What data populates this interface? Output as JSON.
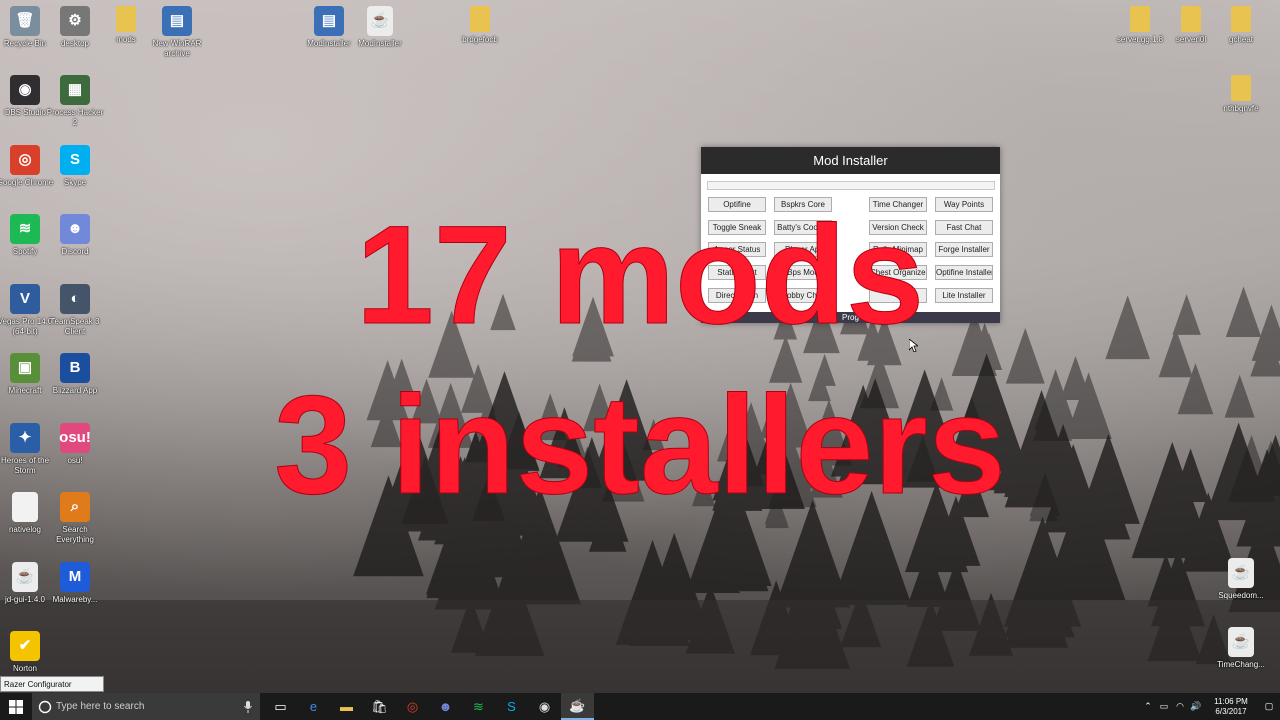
{
  "desktop": {
    "icons_left": [
      {
        "label": "Recycle Bin",
        "glyph": "🗑",
        "color": "#7a8e9e"
      },
      {
        "label": "desktop",
        "glyph": "⚙",
        "color": "#777777"
      },
      {
        "label": "mods",
        "glyph": "",
        "color": "#e8c350"
      },
      {
        "label": "New WinRAR archive",
        "glyph": "▤",
        "color": "#3b6fb6"
      },
      {
        "label": "OBS Studio",
        "glyph": "◉",
        "color": "#302e31"
      },
      {
        "label": "Process Hacker 2",
        "glyph": "▦",
        "color": "#3d6b3d"
      },
      {
        "label": "Google Chrome",
        "glyph": "◎",
        "color": "#d9402b"
      },
      {
        "label": "Skype",
        "glyph": "S",
        "color": "#00aff0"
      },
      {
        "label": "Spotify",
        "glyph": "≋",
        "color": "#1db954"
      },
      {
        "label": "Discord",
        "glyph": "☻",
        "color": "#7289da"
      },
      {
        "label": "Vegas Pro 14.0 (64-bit)",
        "glyph": "V",
        "color": "#2f5c9c"
      },
      {
        "label": "TeamSpeak 3 Client",
        "glyph": "◐",
        "color": "#44556a"
      },
      {
        "label": "Minecraft",
        "glyph": "▣",
        "color": "#5a8f3a"
      },
      {
        "label": "Blizzard App",
        "glyph": "B",
        "color": "#1b4f9e"
      },
      {
        "label": "Heroes of the Storm",
        "glyph": "✦",
        "color": "#2a5fa8"
      },
      {
        "label": "osu!",
        "glyph": "osu!",
        "color": "#e0487e"
      },
      {
        "label": "nativelog",
        "glyph": "",
        "color": "#f2f2f2"
      },
      {
        "label": "Search Everything",
        "glyph": "⌕",
        "color": "#e07b1c"
      },
      {
        "label": "jd-gui-1.4.0",
        "glyph": "☕",
        "color": "#ececec"
      },
      {
        "label": "Malwareby...",
        "glyph": "M",
        "color": "#1d5bd8"
      },
      {
        "label": "Norton",
        "glyph": "✔",
        "color": "#f5c400"
      }
    ],
    "icons_top": [
      {
        "label": "ModInstaller",
        "glyph": "▤",
        "color": "#3b6fb6"
      },
      {
        "label": "ModInstaller",
        "glyph": "☕",
        "color": "#ececec"
      },
      {
        "label": "brdgefocb",
        "glyph": "",
        "color": "#e8c350"
      }
    ],
    "icons_right": [
      {
        "label": "server.gg.1.8",
        "glyph": "",
        "color": "#e8c350"
      },
      {
        "label": "serverl0l",
        "glyph": "",
        "color": "#e8c350"
      },
      {
        "label": "gcheat",
        "glyph": "",
        "color": "#e8c350"
      },
      {
        "label": "nthbgnvfe",
        "glyph": "",
        "color": "#e8c350"
      },
      {
        "label": "Squeedom...",
        "glyph": "☕",
        "color": "#ececec"
      },
      {
        "label": "TimeChang...",
        "glyph": "☕",
        "color": "#ececec"
      }
    ]
  },
  "mod_installer": {
    "title": "Mod Installer",
    "footer": "Prog",
    "progress_fraction": 0,
    "buttons": {
      "col1": [
        "Optifine",
        "Toggle Sneak",
        "Armor Status",
        "Status Text",
        "Direct Conn"
      ],
      "col2": [
        "Bspkrs Core",
        "Batty's Coords",
        "Player Api",
        "Bps Mod",
        "Lobby Chat"
      ],
      "col3": [
        "Time Changer",
        "Version Check",
        "Rei's Minimap",
        "Chest Organizer",
        ""
      ],
      "col4": [
        "Way Points",
        "Fast Chat",
        "Forge Installer",
        "Optifine Installer",
        "Lite Installer"
      ]
    }
  },
  "overlay": {
    "line1": "17 mods",
    "line2": "3 installers",
    "color": "#ff1a2e"
  },
  "tooltip": "Razer Configurator",
  "taskbar": {
    "search_placeholder": "Type here to search",
    "apps": [
      {
        "icon": "task-view-icon",
        "glyph": "▭",
        "color": "#ffffff"
      },
      {
        "icon": "edge-icon",
        "glyph": "e",
        "color": "#3b8ee6"
      },
      {
        "icon": "file-explorer-icon",
        "glyph": "▬",
        "color": "#e8c350"
      },
      {
        "icon": "store-icon",
        "glyph": "🛍",
        "color": "#ffffff"
      },
      {
        "icon": "chrome-icon",
        "glyph": "◎",
        "color": "#d9402b"
      },
      {
        "icon": "discord-icon",
        "glyph": "☻",
        "color": "#7289da"
      },
      {
        "icon": "spotify-icon",
        "glyph": "≋",
        "color": "#1db954"
      },
      {
        "icon": "skype-icon",
        "glyph": "S",
        "color": "#00aff0"
      },
      {
        "icon": "obs-icon",
        "glyph": "◉",
        "color": "#dddddd"
      },
      {
        "icon": "java-icon",
        "glyph": "☕",
        "color": "#e0e0e0"
      }
    ],
    "time": "11:06 PM",
    "date": "6/3/2017"
  }
}
